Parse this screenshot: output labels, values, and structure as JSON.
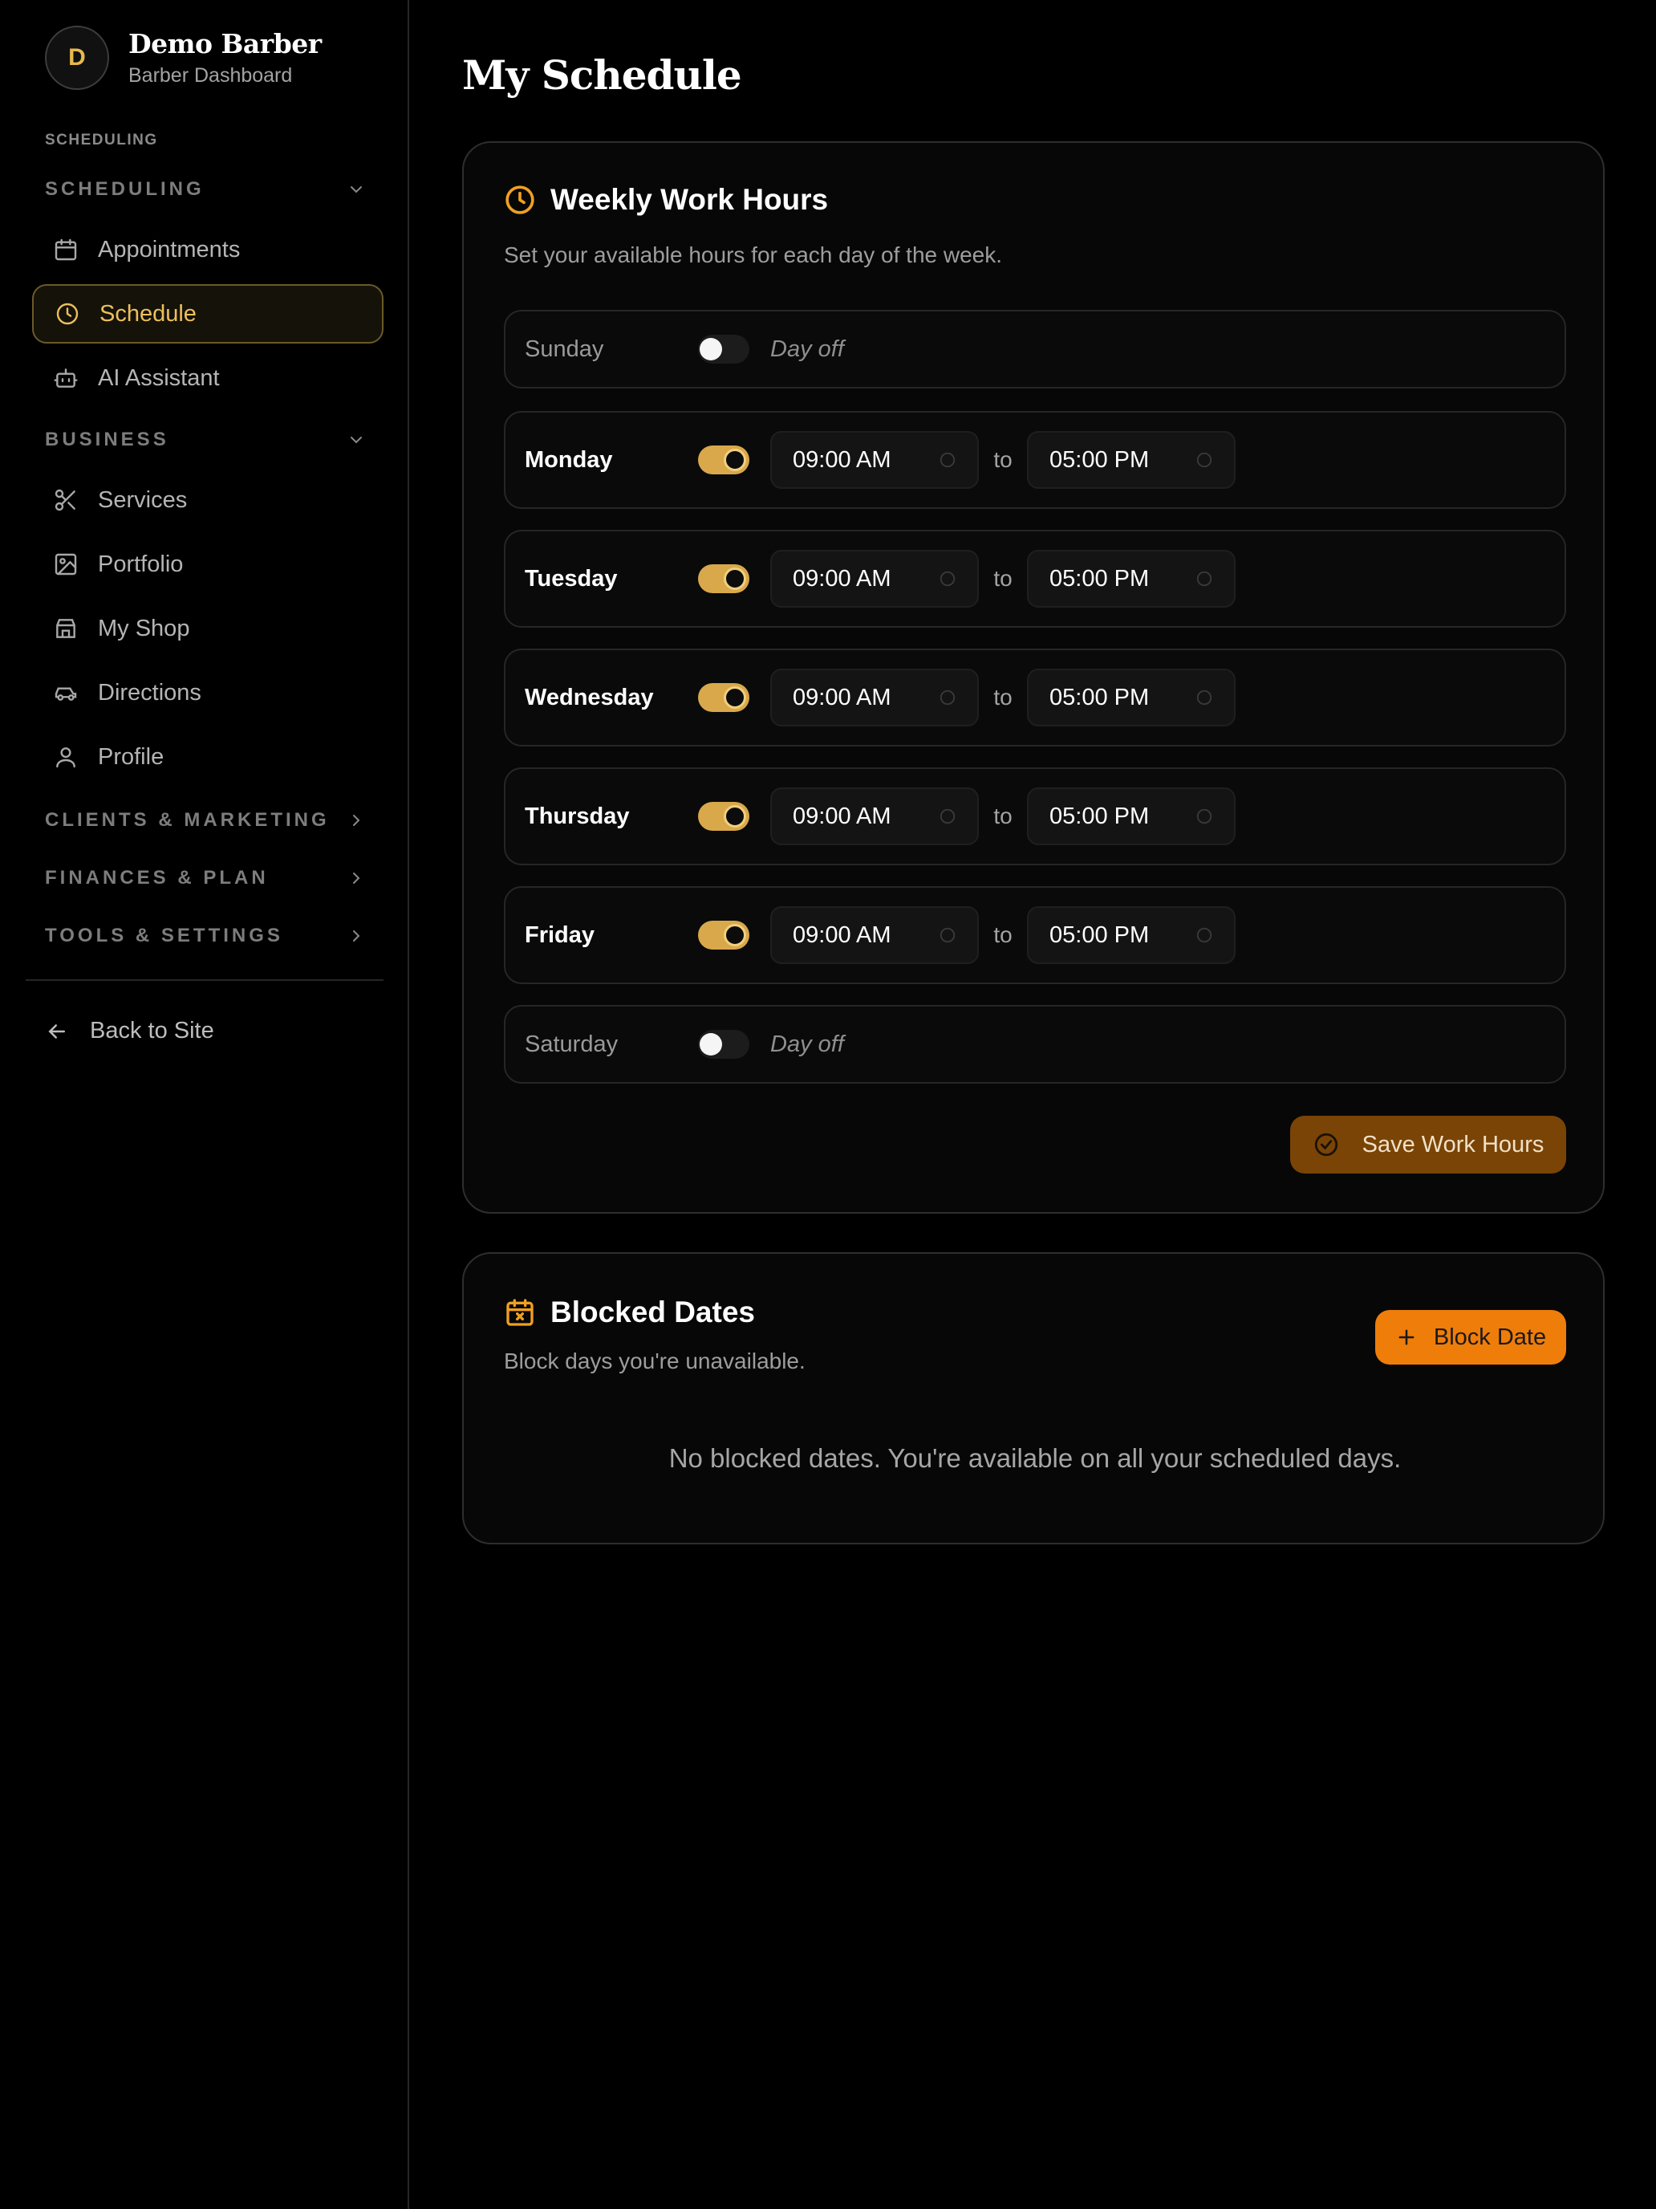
{
  "brand": {
    "avatar_letter": "D",
    "name": "Demo Barber",
    "subtitle": "Barber Dashboard"
  },
  "sidebar": {
    "section_tag": "SCHEDULING",
    "groups": {
      "scheduling": "SCHEDULING",
      "business": "BUSINESS",
      "clients_marketing": "CLIENTS & MARKETING",
      "finances_plan": "FINANCES & PLAN",
      "tools_settings": "TOOLS & SETTINGS"
    },
    "items": [
      {
        "label": "Appointments",
        "icon": "calendar-icon"
      },
      {
        "label": "Schedule",
        "icon": "clock-icon",
        "active": true
      },
      {
        "label": "AI Assistant",
        "icon": "bot-icon"
      },
      {
        "label": "Services",
        "icon": "scissors-icon"
      },
      {
        "label": "Portfolio",
        "icon": "image-icon"
      },
      {
        "label": "My Shop",
        "icon": "store-icon"
      },
      {
        "label": "Directions",
        "icon": "car-icon"
      },
      {
        "label": "Profile",
        "icon": "user-icon"
      }
    ],
    "back_label": "Back to Site"
  },
  "page": {
    "title": "My Schedule"
  },
  "work_hours": {
    "title": "Weekly Work Hours",
    "subtitle": "Set your available hours for each day of the week.",
    "days": [
      {
        "name": "Sunday",
        "enabled": false,
        "off_label": "Day off"
      },
      {
        "name": "Monday",
        "enabled": true,
        "start": "09:00 AM",
        "end": "05:00 PM"
      },
      {
        "name": "Tuesday",
        "enabled": true,
        "start": "09:00 AM",
        "end": "05:00 PM"
      },
      {
        "name": "Wednesday",
        "enabled": true,
        "start": "09:00 AM",
        "end": "05:00 PM"
      },
      {
        "name": "Thursday",
        "enabled": true,
        "start": "09:00 AM",
        "end": "05:00 PM"
      },
      {
        "name": "Friday",
        "enabled": true,
        "start": "09:00 AM",
        "end": "05:00 PM"
      },
      {
        "name": "Saturday",
        "enabled": false,
        "off_label": "Day off"
      }
    ],
    "to_label": "to",
    "save_label": "Save Work Hours"
  },
  "blocked": {
    "title": "Blocked Dates",
    "subtitle": "Block days you're unavailable.",
    "button_label": "Block Date",
    "empty_message": "No blocked dates. You're available on all your scheduled days."
  },
  "colors": {
    "accent": "#ECC05A",
    "orange": "#EF7D0A",
    "background": "#000000"
  }
}
